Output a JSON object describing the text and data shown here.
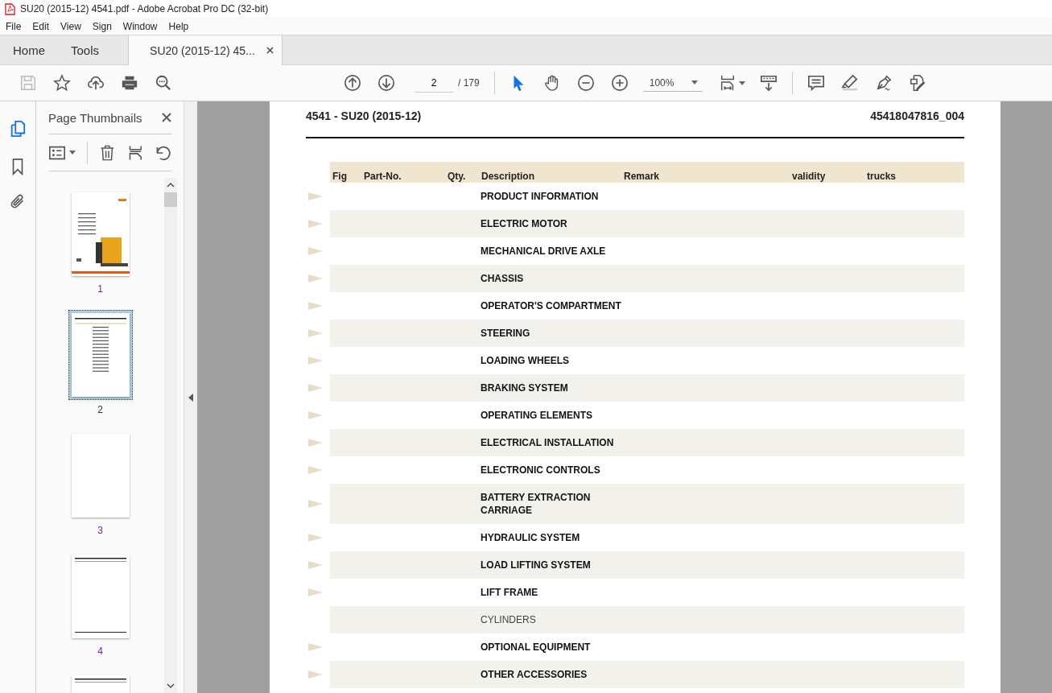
{
  "window": {
    "title": "SU20 (2015-12) 4541.pdf - Adobe Acrobat Pro DC (32-bit)"
  },
  "menu": [
    "File",
    "Edit",
    "View",
    "Sign",
    "Window",
    "Help"
  ],
  "tabs": [
    {
      "label": "Home",
      "selected": false,
      "closable": false
    },
    {
      "label": "Tools",
      "selected": false,
      "closable": false
    },
    {
      "label": "SU20 (2015-12) 45...",
      "selected": true,
      "closable": true
    }
  ],
  "toolbar": {
    "page": "2",
    "page_total": "/ 179",
    "zoom": "100%"
  },
  "sidebar": {
    "title": "Page Thumbnails",
    "thumbnails": [
      {
        "label": "1",
        "kind": "cover",
        "selected": false
      },
      {
        "label": "2",
        "kind": "table",
        "selected": true
      },
      {
        "label": "3",
        "kind": "blank",
        "selected": false
      },
      {
        "label": "4",
        "kind": "table-header",
        "selected": false
      },
      {
        "kind": "table-header",
        "selected": false
      }
    ]
  },
  "document": {
    "header_left": "4541 - SU20 (2015-12)",
    "header_right": "45418047816_004",
    "columns": [
      "Fig",
      "Part-No.",
      "Qty.",
      "Description",
      "Remark",
      "validity",
      "trucks"
    ],
    "rows": [
      {
        "description": "PRODUCT INFORMATION",
        "marker": true,
        "bold": true
      },
      {
        "description": "ELECTRIC MOTOR",
        "marker": true,
        "bold": true
      },
      {
        "description": "MECHANICAL DRIVE AXLE",
        "marker": true,
        "bold": true
      },
      {
        "description": "CHASSIS",
        "marker": true,
        "bold": true
      },
      {
        "description": "OPERATOR'S COMPARTMENT",
        "marker": true,
        "bold": true
      },
      {
        "description": "STEERING",
        "marker": true,
        "bold": true
      },
      {
        "description": "LOADING WHEELS",
        "marker": true,
        "bold": true
      },
      {
        "description": "BRAKING SYSTEM",
        "marker": true,
        "bold": true
      },
      {
        "description": "OPERATING ELEMENTS",
        "marker": true,
        "bold": true
      },
      {
        "description": "ELECTRICAL INSTALLATION",
        "marker": true,
        "bold": true
      },
      {
        "description": "ELECTRONIC CONTROLS",
        "marker": true,
        "bold": true
      },
      {
        "description": "BATTERY EXTRACTION CARRIAGE",
        "marker": true,
        "bold": true
      },
      {
        "description": "HYDRAULIC SYSTEM",
        "marker": true,
        "bold": true
      },
      {
        "description": "LOAD LIFTING SYSTEM",
        "marker": true,
        "bold": true
      },
      {
        "description": "LIFT FRAME",
        "marker": true,
        "bold": true
      },
      {
        "description": "CYLINDERS",
        "marker": false,
        "bold": false
      },
      {
        "description": "OPTIONAL EQUIPMENT",
        "marker": true,
        "bold": true
      },
      {
        "description": "OTHER ACCESSORIES",
        "marker": true,
        "bold": true
      }
    ]
  }
}
